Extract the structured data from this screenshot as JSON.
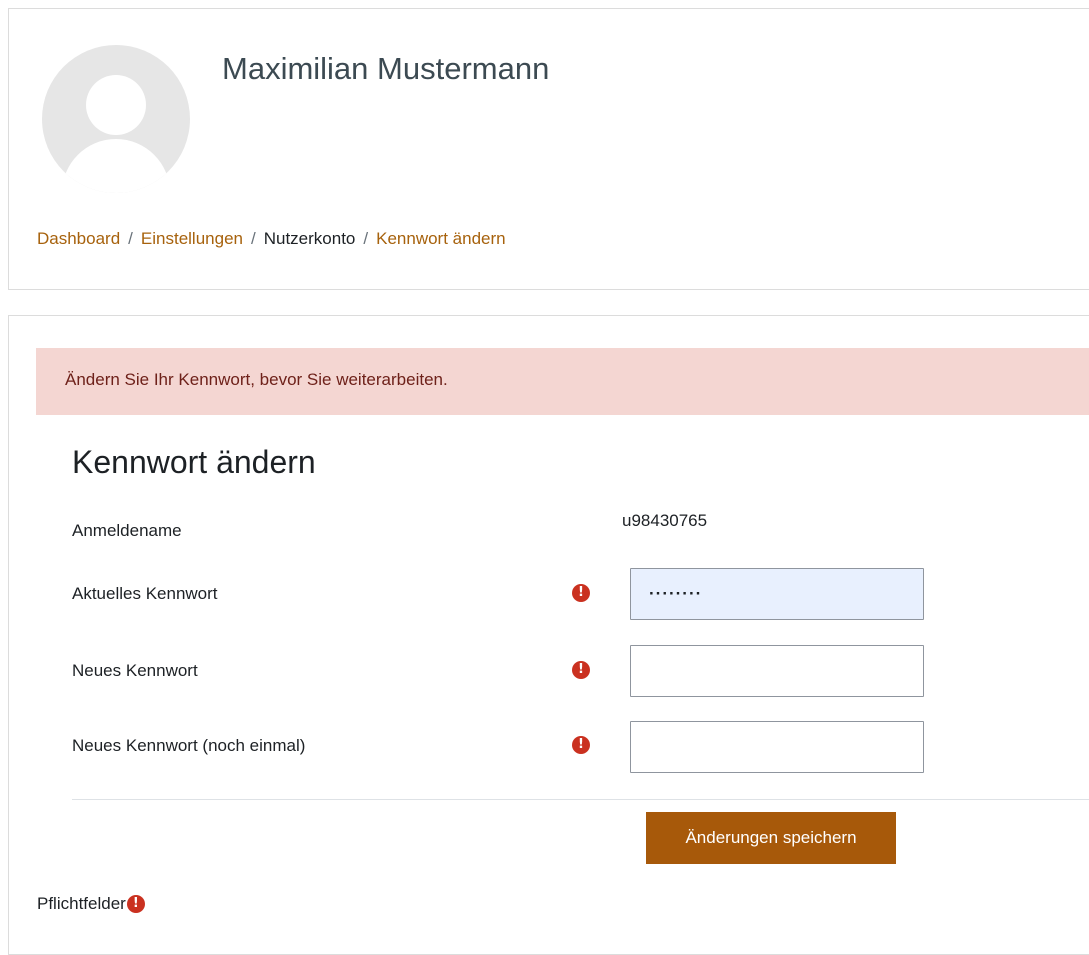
{
  "profile": {
    "name": "Maximilian Mustermann"
  },
  "breadcrumb": {
    "items": [
      "Dashboard",
      "Einstellungen",
      "Nutzerkonto",
      "Kennwort ändern"
    ],
    "separator": "/"
  },
  "alert": {
    "text": "Ändern Sie Ihr Kennwort, bevor Sie weiterarbeiten.",
    "background": "#f4d6d2",
    "color": "#6e211a"
  },
  "form": {
    "title": "Kennwort ändern",
    "username_label": "Anmeldename",
    "username_value": "u98430765",
    "current_password_label": "Aktuelles Kennwort",
    "current_password_value": "········",
    "new_password_label": "Neues Kennwort",
    "new_password_value": "",
    "confirm_password_label": "Neues Kennwort (noch einmal)",
    "confirm_password_value": "",
    "required_icon": "!",
    "save_label": "Änderungen speichern",
    "required_note": "Pflichtfelder"
  },
  "colors": {
    "link": "#a7620d",
    "button": "#a7590a",
    "required": "#ca3120",
    "filled_field": "#e8f0fe"
  }
}
